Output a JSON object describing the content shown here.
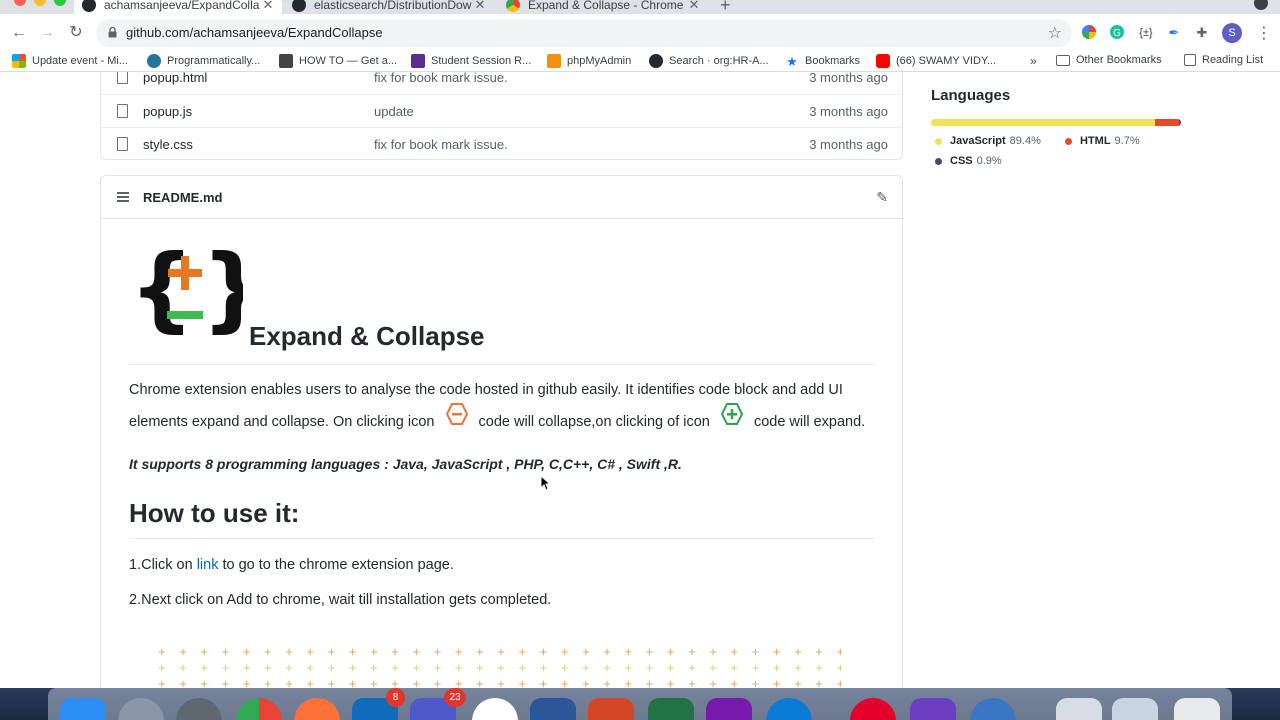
{
  "browser": {
    "tabs": [
      {
        "title": "achamsanjeeva/ExpandCollapse",
        "active": true
      },
      {
        "title": "elasticsearch/DistributionDown",
        "active": false
      },
      {
        "title": "Expand & Collapse - Chrome W",
        "active": false
      }
    ],
    "url": "github.com/achamsanjeeva/ExpandCollapse",
    "profile_initial": "S"
  },
  "bookmarks": {
    "items": [
      "Update event - Mi...",
      "Programmatically...",
      "HOW TO — Get a...",
      "Student Session R...",
      "phpMyAdmin",
      "Search · org:HR-A...",
      "Bookmarks",
      "(66) SWAMY VIDY..."
    ],
    "overflow": "»",
    "other": "Other Bookmarks",
    "reading_list": "Reading List"
  },
  "files": [
    {
      "name": "popup.html",
      "message": "fix for book mark issue.",
      "age": "3 months ago"
    },
    {
      "name": "popup.js",
      "message": "update",
      "age": "3 months ago"
    },
    {
      "name": "style.css",
      "message": "fix for book mark issue.",
      "age": "3 months ago"
    }
  ],
  "readme": {
    "filename": "README.md",
    "heading": "Expand & Collapse",
    "desc_line1": "Chrome extension enables users to analyse the code hosted in github easily. It identifies code block and add UI",
    "desc_line2_a": "elements expand and collapse. On clicking icon",
    "desc_line2_b": "code will collapse,on clicking of icon",
    "desc_line2_c": "code will expand.",
    "supports": "It supports 8 programming languages : Java, JavaScript , PHP, C,C++, C# , Swift ,R.",
    "howto_heading": "How to use it:",
    "step1_a": "1.Click on",
    "step1_link": "link",
    "step1_b": "to go to the chrome extension page.",
    "step2": "2.Next click on Add to chrome, wait till installation gets completed."
  },
  "languages": {
    "title": "Languages",
    "items": [
      {
        "name": "JavaScript",
        "percent": "89.4%",
        "value": 89.4,
        "color": "#f1e05a"
      },
      {
        "name": "HTML",
        "percent": "9.7%",
        "value": 9.7,
        "color": "#e34c26"
      },
      {
        "name": "CSS",
        "percent": "0.9%",
        "value": 0.9,
        "color": "#563d7c"
      }
    ]
  },
  "dock": {
    "badges": {
      "outlook": "8",
      "teams": "23"
    }
  }
}
